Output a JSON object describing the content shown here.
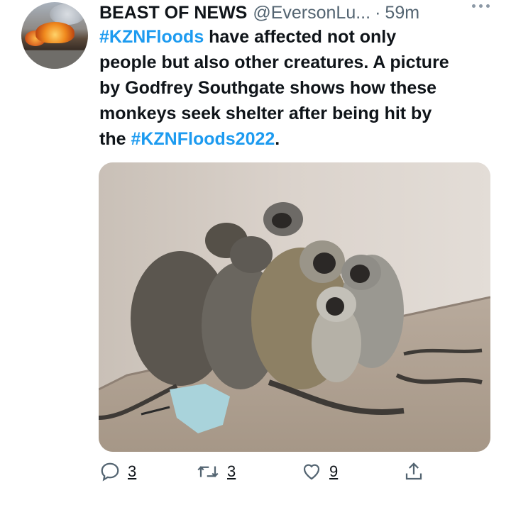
{
  "tweet": {
    "author_name": "BEAST OF NEWS",
    "handle": "@EversonLu...",
    "separator": "·",
    "time": "59m",
    "text_lines": [
      {
        "parts": [
          {
            "t": "#KZNFloods",
            "tag": true
          },
          {
            "t": " have affected not only",
            "tag": false
          }
        ]
      },
      {
        "parts": [
          {
            "t": "people but also other creatures. A picture",
            "tag": false
          }
        ]
      },
      {
        "parts": [
          {
            "t": "by Godfrey Southgate shows how these",
            "tag": false
          }
        ]
      },
      {
        "parts": [
          {
            "t": "monkeys seek shelter after being hit by",
            "tag": false
          }
        ]
      },
      {
        "parts": [
          {
            "t": "the ",
            "tag": false
          },
          {
            "t": "#KZNFloods2022",
            "tag": true
          },
          {
            "t": ".",
            "tag": false
          }
        ]
      }
    ],
    "hashtag_color": "#1d9bf0",
    "photo_icon": "monkeys-photo"
  },
  "actions": {
    "reply_count": "3",
    "retweet_count": "3",
    "like_count": "9",
    "icons": [
      "reply-icon",
      "retweet-icon",
      "like-icon",
      "share-icon"
    ]
  }
}
